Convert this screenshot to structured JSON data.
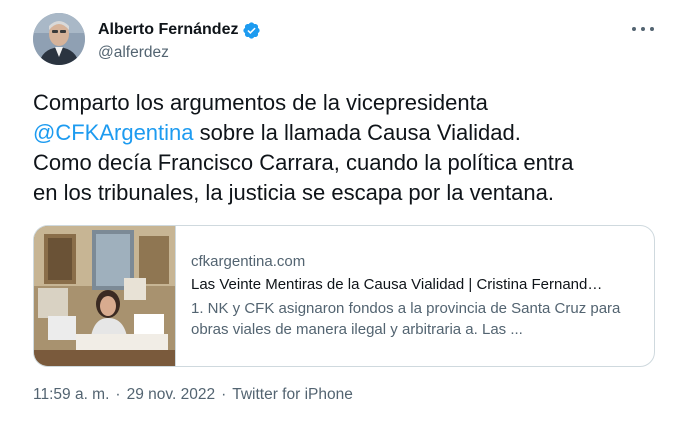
{
  "author": {
    "display_name": "Alberto Fernández",
    "handle": "@alferdez",
    "verified": true,
    "avatar_icon": "profile-photo"
  },
  "more_menu": {
    "icon": "more-horizontal-icon"
  },
  "tweet": {
    "text_before": "Comparto los argumentos de la vicepresidenta\n",
    "mention": "@CFKArgentina",
    "text_after": " sobre la llamada Causa Vialidad.\nComo decía Francisco Carrara, cuando la política entra\nen los tribunales, la justicia se escapa por la ventana."
  },
  "card": {
    "domain": "cfkargentina.com",
    "title": "Las Veinte Mentiras de la Causa Vialidad | Cristina Fernand…",
    "description": "1. NK y CFK asignaron fondos a la provincia de Santa Cruz para obras viales de manera ilegal y arbitraria a. Las ..."
  },
  "meta": {
    "time": "11:59 a. m.",
    "separator": "·",
    "date": "29 nov. 2022",
    "source": "Twitter for iPhone"
  },
  "colors": {
    "link": "#1d9bf0",
    "text": "#0f1419",
    "secondary": "#536471",
    "border": "#cfd9de"
  }
}
